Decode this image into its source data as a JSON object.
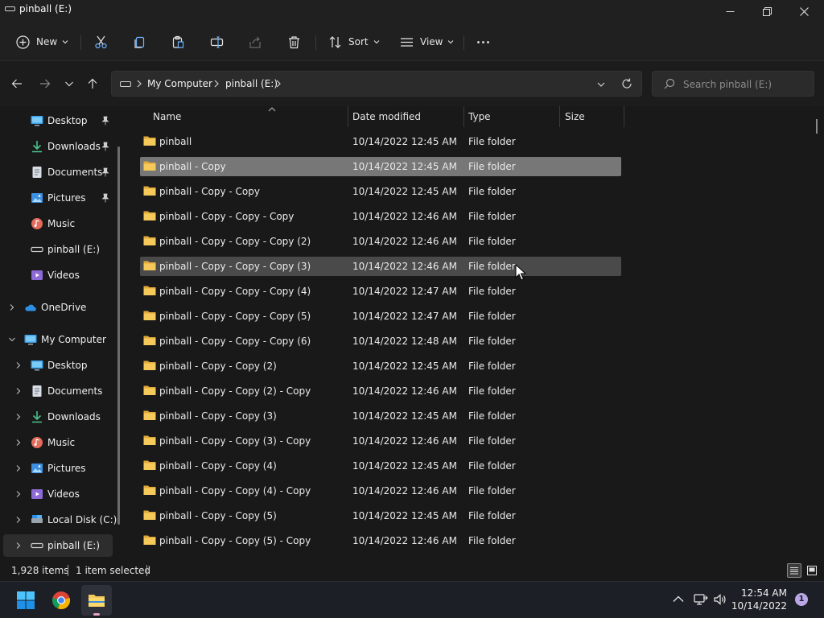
{
  "window": {
    "title": "pinball (E:)",
    "controls": [
      "minimize",
      "maximize",
      "close"
    ]
  },
  "toolbar": {
    "new_label": "New",
    "sort_label": "Sort",
    "view_label": "View",
    "icons": [
      "cut-icon",
      "copy-icon",
      "paste-icon",
      "rename-icon",
      "share-icon",
      "delete-icon",
      "more-icon"
    ]
  },
  "address": {
    "breadcrumbs": [
      "My Computer",
      "pinball (E:)"
    ]
  },
  "search": {
    "placeholder": "Search pinball (E:)"
  },
  "sidebar": {
    "quick_access": [
      {
        "label": "Desktop",
        "icon": "desktop-icon",
        "pinned": true
      },
      {
        "label": "Downloads",
        "icon": "downloads-icon",
        "pinned": true
      },
      {
        "label": "Documents",
        "icon": "documents-icon",
        "pinned": true
      },
      {
        "label": "Pictures",
        "icon": "pictures-icon",
        "pinned": true
      },
      {
        "label": "Music",
        "icon": "music-icon",
        "pinned": false
      },
      {
        "label": "pinball (E:)",
        "icon": "drive-icon",
        "pinned": false
      },
      {
        "label": "Videos",
        "icon": "videos-icon",
        "pinned": false
      }
    ],
    "onedrive": "OneDrive",
    "my_computer": "My Computer",
    "computer_items": [
      {
        "label": "Desktop",
        "icon": "desktop-icon"
      },
      {
        "label": "Documents",
        "icon": "documents-icon"
      },
      {
        "label": "Downloads",
        "icon": "downloads-icon"
      },
      {
        "label": "Music",
        "icon": "music-icon"
      },
      {
        "label": "Pictures",
        "icon": "pictures-icon"
      },
      {
        "label": "Videos",
        "icon": "videos-icon"
      },
      {
        "label": "Local Disk (C:)",
        "icon": "local-disk-icon"
      },
      {
        "label": "pinball (E:)",
        "icon": "drive-icon",
        "active": true
      }
    ]
  },
  "columns": {
    "name": "Name",
    "date": "Date modified",
    "type": "Type",
    "size": "Size"
  },
  "files": [
    {
      "name": "pinball",
      "date": "10/14/2022 12:45 AM",
      "type": "File folder"
    },
    {
      "name": "pinball - Copy",
      "date": "10/14/2022 12:45 AM",
      "type": "File folder",
      "state": "selected"
    },
    {
      "name": "pinball - Copy - Copy",
      "date": "10/14/2022 12:45 AM",
      "type": "File folder"
    },
    {
      "name": "pinball - Copy - Copy - Copy",
      "date": "10/14/2022 12:46 AM",
      "type": "File folder"
    },
    {
      "name": "pinball - Copy - Copy - Copy (2)",
      "date": "10/14/2022 12:46 AM",
      "type": "File folder"
    },
    {
      "name": "pinball - Copy - Copy - Copy (3)",
      "date": "10/14/2022 12:46 AM",
      "type": "File folder",
      "state": "hover"
    },
    {
      "name": "pinball - Copy - Copy - Copy (4)",
      "date": "10/14/2022 12:47 AM",
      "type": "File folder"
    },
    {
      "name": "pinball - Copy - Copy - Copy (5)",
      "date": "10/14/2022 12:47 AM",
      "type": "File folder"
    },
    {
      "name": "pinball - Copy - Copy - Copy (6)",
      "date": "10/14/2022 12:48 AM",
      "type": "File folder"
    },
    {
      "name": "pinball - Copy - Copy (2)",
      "date": "10/14/2022 12:45 AM",
      "type": "File folder"
    },
    {
      "name": "pinball - Copy - Copy (2) - Copy",
      "date": "10/14/2022 12:46 AM",
      "type": "File folder"
    },
    {
      "name": "pinball - Copy - Copy (3)",
      "date": "10/14/2022 12:45 AM",
      "type": "File folder"
    },
    {
      "name": "pinball - Copy - Copy (3) - Copy",
      "date": "10/14/2022 12:46 AM",
      "type": "File folder"
    },
    {
      "name": "pinball - Copy - Copy (4)",
      "date": "10/14/2022 12:45 AM",
      "type": "File folder"
    },
    {
      "name": "pinball - Copy - Copy (4) - Copy",
      "date": "10/14/2022 12:46 AM",
      "type": "File folder"
    },
    {
      "name": "pinball - Copy - Copy (5)",
      "date": "10/14/2022 12:45 AM",
      "type": "File folder"
    },
    {
      "name": "pinball - Copy - Copy (5) - Copy",
      "date": "10/14/2022 12:46 AM",
      "type": "File folder"
    }
  ],
  "status": {
    "item_count": "1,928 items",
    "selection": "1 item selected"
  },
  "taskbar": {
    "apps": [
      "start-icon",
      "chrome-icon",
      "file-explorer-icon"
    ],
    "time": "12:54 AM",
    "date": "10/14/2022",
    "notification_count": "1"
  },
  "colors": {
    "folder": "#f6c95b",
    "selected_row": "#777777",
    "hover_row": "#4a4a4a",
    "accent_pink": "#e8a2c8"
  }
}
